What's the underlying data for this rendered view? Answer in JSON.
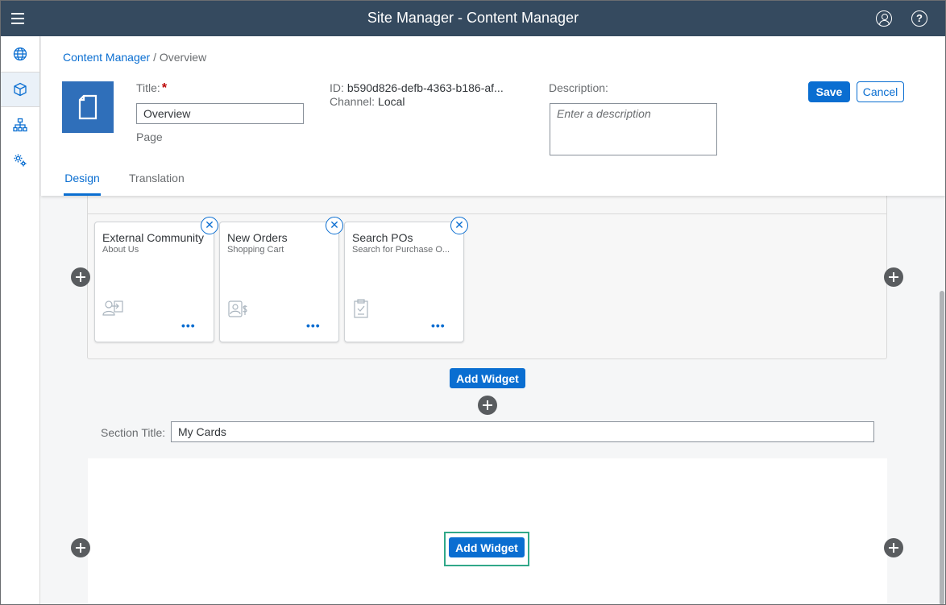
{
  "shell": {
    "title": "Site Manager - Content Manager"
  },
  "sidenav": {
    "items": [
      {
        "icon": "globe-icon"
      },
      {
        "icon": "content-cube-icon",
        "active": true
      },
      {
        "icon": "hierarchy-icon"
      },
      {
        "icon": "settings-gear-icon"
      }
    ]
  },
  "breadcrumb": {
    "link": "Content Manager",
    "separator": "/",
    "current": "Overview"
  },
  "header": {
    "title_label": "Title:",
    "required_mark": "*",
    "title_value": "Overview",
    "type": "Page",
    "id_label": "ID:",
    "id_value": "b590d826-defb-4363-b186-af...",
    "channel_label": "Channel:",
    "channel_value": "Local",
    "description_label": "Description:",
    "description_placeholder": "Enter a description",
    "save_label": "Save",
    "cancel_label": "Cancel"
  },
  "tabs": [
    {
      "label": "Design",
      "selected": true
    },
    {
      "label": "Translation",
      "selected": false
    }
  ],
  "cards": [
    {
      "title": "External Community",
      "subtitle": "About Us",
      "icon": "user-arrow-icon"
    },
    {
      "title": "New Orders",
      "subtitle": "Shopping Cart",
      "icon": "customer-money-icon"
    },
    {
      "title": "Search POs",
      "subtitle": "Search for Purchase O...",
      "icon": "clipboard-check-icon"
    }
  ],
  "card_more": "•••",
  "card_close": "✕",
  "add_widget_label": "Add Widget",
  "section": {
    "title_label": "Section Title:",
    "title_value": "My Cards"
  },
  "colors": {
    "shell_bg": "#354a5f",
    "accent": "#0a6ed1",
    "highlight": "#31a889"
  }
}
